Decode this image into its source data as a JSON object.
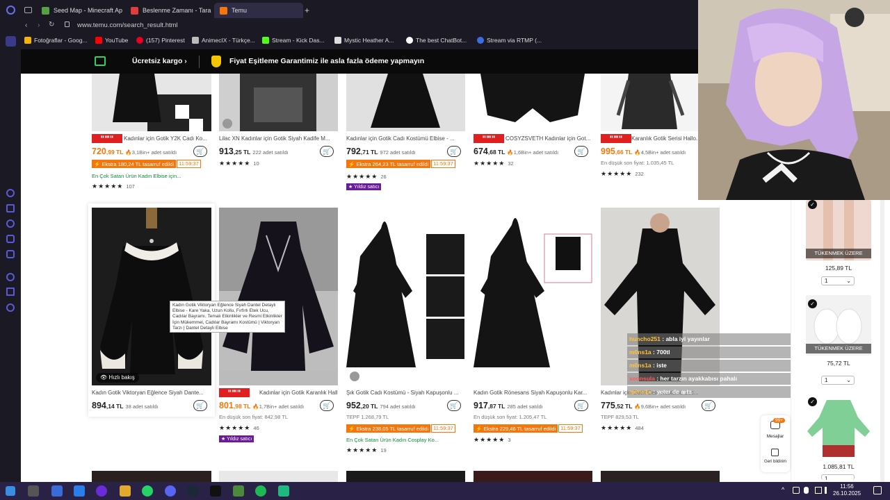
{
  "browser": {
    "tabs": [
      {
        "label": "Seed Map - Minecraft Ap"
      },
      {
        "label": "Beslenme Zamanı - Taran"
      },
      {
        "label": "Temu"
      }
    ],
    "url": "www.temu.com/search_result.html",
    "bookmarks": [
      "Fotoğraflar - Goog...",
      "YouTube",
      "(157) Pinterest",
      "AnimecIX - Türkçe...",
      "Stream - Kick Das...",
      "Mystic Heather A...",
      "The best ChatBot...",
      "Stream via RTMP (..."
    ]
  },
  "promo": {
    "free_shipping": "Ücretsiz kargo",
    "guarantee": "Fiyat Eşitleme Garantimiz ile asla fazla ödeme yapmayın"
  },
  "row1": [
    {
      "title": "Kadınlar için Gotik Y2K Cadı Ko...",
      "price_main": "720",
      "price_dec": ",99 TL",
      "price_color": "orange",
      "sold": "🔥3,1Bin+ adet satıldı",
      "badge": "Ekstra 180,24 TL tasarruf edildi",
      "timer": "11:59:37",
      "extra": "En Çok Satan Ürün  Kadın Elbise için...",
      "stars": "★★★★★",
      "reviews": "107",
      "has_mini_badge": true
    },
    {
      "title": "Lilac XN Kadınlar için Gotik Siyah Kadife M...",
      "price_main": "913",
      "price_dec": ",25 TL",
      "price_color": "black",
      "sold": "222 adet satıldı",
      "stars": "★★★★★",
      "reviews": "10"
    },
    {
      "title": "Kadınlar için Gotik Cadı Kostümü Elbise - ...",
      "price_main": "792",
      "price_dec": ",71 TL",
      "price_color": "black",
      "sold": "972 adet satıldı",
      "badge": "Ekstra 264,23 TL tasarruf edildi",
      "timer": "11:59:37",
      "stars": "★★★★★",
      "reviews": "26",
      "purple": "Yıldız satıcı"
    },
    {
      "title": "COSYZSVETH Kadınlar için Got...",
      "price_main": "674",
      "price_dec": ",68 TL",
      "price_color": "black",
      "sold": "🔥1,6Bin+ adet satıldı",
      "stars": "★★★★★",
      "reviews": "32",
      "has_mini_badge": true
    },
    {
      "title": "Karanlık Gotik Serisi Hallo...",
      "price_main": "995",
      "price_dec": ",66 TL",
      "price_color": "orange",
      "sold": "🔥4,5Bin+ adet satıldı",
      "lowest": "En düşük son fiyat: 1.035,45 TL",
      "stars": "★★★★★",
      "reviews": "232",
      "has_mini_badge": true
    }
  ],
  "row2": [
    {
      "title": "Kadın Gotik Viktoryan Eğlence Siyah Dante...",
      "price_main": "894",
      "price_dec": ",14 TL",
      "price_color": "black",
      "sold": "38 adet satıldı",
      "quick": "Hızlı bakış"
    },
    {
      "title": "Kadınlar için Gotik Karanlık Hall...",
      "price_main": "801",
      "price_dec": ",98 TL",
      "price_color": "orange",
      "sold": "🔥1,7Bin+ adet satıldı",
      "lowest": "En düşük son fiyat: 842,98 TL",
      "stars": "★★★★★",
      "reviews": "46",
      "purple": "Yıldız satıcı",
      "has_mini_badge": true
    },
    {
      "title": "Şık Gotik Cadı Kostümü - Siyah Kapuşonlu ...",
      "price_main": "952",
      "price_dec": ",20 TL",
      "price_color": "black",
      "sold": "794 adet satıldı",
      "lowest": "TEPF 1.268,79 TL",
      "badge": "Ekstra 238,05 TL tasarruf edildi",
      "timer": "11:59:37",
      "extra": "En Çok Satan Ürün  Kadın Cosplay Ko...",
      "stars": "★★★★★",
      "reviews": "19"
    },
    {
      "title": "Kadın Gotik Rönesans Siyah Kapuşonlu Kar...",
      "price_main": "917",
      "price_dec": ",87 TL",
      "price_color": "black",
      "sold": "285 adet satıldı",
      "lowest": "En düşük son fiyat: 1.205,47 TL",
      "badge": "Ekstra 229,46 TL tasarruf edildi",
      "timer": "11:59:37",
      "stars": "★★★★★",
      "reviews": "3"
    },
    {
      "title": "Kadınlar için Gotik Cadı Kostümü Sec...",
      "price_main": "775",
      "price_dec": ",52 TL",
      "price_color": "black",
      "sold": "🔥9,6Bin+ adet satıldı",
      "lowest": "TEPF 829,53 TL",
      "stars": "★★★★★",
      "reviews": "484"
    }
  ],
  "tooltip": "Kadın Gotik Viktoryan Eğlence Siyah Dantel Detaylı Elbise - Kare Yaka, Uzun Kollu, Fırfırlı Etek Ucu, Cadılar Bayramı, Temalı Etkinlikler ve Resmi Etkinlikler İçin Mükemmel, Cadılar Bayramı Kostümü | Viktoryan Tarzı | Dantel Detaylı Elbise",
  "chat": [
    {
      "user": "huncho251",
      "msg": ": abla iyi yayınlar"
    },
    {
      "user": "m0ns1a",
      "msg": ": 700tl"
    },
    {
      "user": "m0ns1a",
      "msg": ": iste"
    },
    {
      "user": "seonsula",
      "msg": ": her tarzın ayakkabısı pahalı"
    },
    {
      "user": "m0ns1a",
      "msg": ": yeter de arta"
    }
  ],
  "cart_panel": {
    "items": [
      {
        "status": "TÜKENMEK ÜZERE",
        "price": "125,89 TL",
        "qty": "1"
      },
      {
        "status": "TÜKENMEK ÜZERE",
        "price": "75,72 TL",
        "qty": "1"
      },
      {
        "status": "",
        "price": "1.085,81 TL",
        "qty": "1"
      }
    ]
  },
  "float": {
    "count": "99+",
    "messages": "Mesajlar",
    "feedback": "Geri bildirim"
  },
  "taskbar": {
    "time": "11:56",
    "date": "26.10.2025"
  },
  "colors": {
    "accent_orange": "#f5760a",
    "purple_badge": "#6a1b9a",
    "taskbar": "#2a2246"
  }
}
